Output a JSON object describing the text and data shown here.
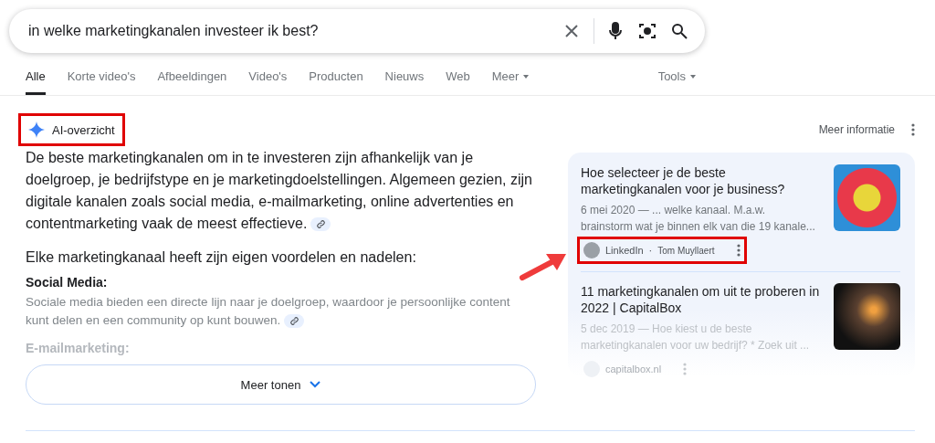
{
  "search": {
    "value": "in welke marketingkanalen investeer ik best?"
  },
  "tabs": [
    {
      "label": "Alle",
      "selected": true,
      "dropdown": false
    },
    {
      "label": "Korte video's",
      "selected": false,
      "dropdown": false
    },
    {
      "label": "Afbeeldingen",
      "selected": false,
      "dropdown": false
    },
    {
      "label": "Video's",
      "selected": false,
      "dropdown": false
    },
    {
      "label": "Producten",
      "selected": false,
      "dropdown": false
    },
    {
      "label": "Nieuws",
      "selected": false,
      "dropdown": false
    },
    {
      "label": "Web",
      "selected": false,
      "dropdown": false
    },
    {
      "label": "Meer",
      "selected": false,
      "dropdown": true
    }
  ],
  "tools": {
    "label": "Tools",
    "dropdown": true
  },
  "ai_overview": {
    "title": "AI-overzicht",
    "highlighted": true,
    "more_info": "Meer informatie",
    "intro": "De beste marketingkanalen om in te investeren zijn afhankelijk van je doelgroep, je bedrijfstype en je marketingdoelstellingen. Algemeen gezien, zijn digitale kanalen zoals social media, e-mailmarketing, online advertenties en contentmarketing vaak de meest effectieve.",
    "subtitle": "Elke marketingkanaal heeft zijn eigen voordelen en nadelen:",
    "sections": [
      {
        "heading": "Social Media:",
        "text": "Sociale media bieden een directe lijn naar je doelgroep, waardoor je persoonlijke content kunt delen en een community op kunt bouwen.",
        "faded": false
      },
      {
        "heading": "E-mailmarketing:",
        "faded": true
      }
    ],
    "show_more": "Meer tonen",
    "sources": [
      {
        "title": "Hoe selecteer je de beste marketingkanalen voor je business?",
        "snippet": "6 mei 2020 — ... welke kanaal. M.a.w. brainstorm wat je binnen elk van die 19 kanale...",
        "site": "LinkedIn",
        "separator": "·",
        "author": "Tom Muyllaert",
        "highlighted": true,
        "faded": false
      },
      {
        "title": "11 marketingkanalen om uit te proberen in 2022 | CapitalBox",
        "snippet": "5 dec 2019 — Hoe kiest u de beste marketingkanalen voor uw bedrijf? * Zoek uit ...",
        "site": "capitalbox.nl",
        "highlighted": false,
        "faded": true
      }
    ]
  }
}
